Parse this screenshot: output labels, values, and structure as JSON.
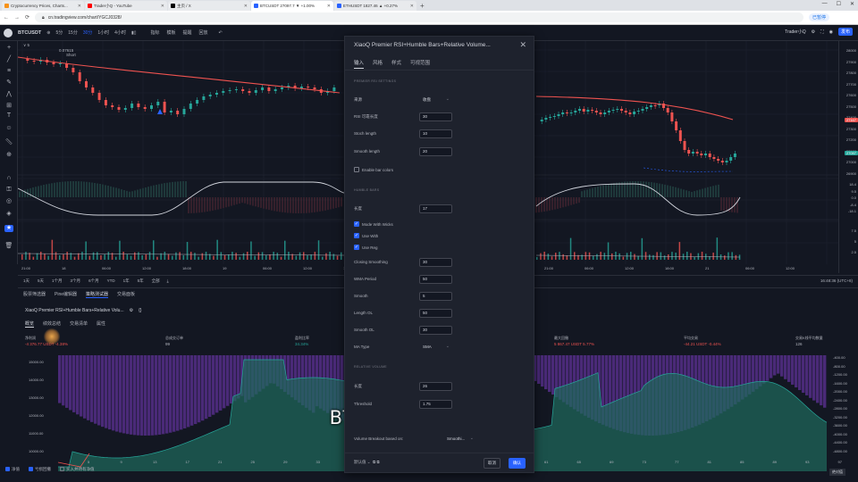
{
  "browser": {
    "tabs": [
      {
        "title": "Cryptocurrency Prices, Charts...",
        "color": "#f7931a"
      },
      {
        "title": "Trader小Q - YouTube",
        "color": "#ff0000"
      },
      {
        "title": "主页 / X",
        "color": "#000000"
      },
      {
        "title": "BTCUSDT 27097.7 ▼ +1.00%",
        "color": "#2962ff",
        "active": true
      },
      {
        "title": "ETHUSDT 1827.46 ▲ +0.27%",
        "color": "#2962ff"
      }
    ],
    "new_tab": "+",
    "url": "cn.tradingview.com/chart/YGCJ0328/",
    "profile": "已暂停"
  },
  "toolbar": {
    "symbol": "BTCUSDT",
    "intervals": [
      "5分",
      "15分",
      "30分",
      "1小时",
      "4小时"
    ],
    "active_interval": "30分",
    "items": [
      "指标",
      "模板",
      "提醒",
      "回放"
    ],
    "right": [
      "Trader小Q",
      "发布"
    ]
  },
  "legend": {
    "line1": "∨ 5",
    "line2": "0.07615",
    "line3": "Short"
  },
  "price_axis": {
    "labels": [
      "28000",
      "27900",
      "27800",
      "27700",
      "27600",
      "27500",
      "27400",
      "27300",
      "27200",
      "27100",
      "27000",
      "26900"
    ],
    "tags": [
      {
        "text": "27167",
        "color": "#ef5350"
      },
      {
        "text": "27097",
        "color": "#26a69a"
      }
    ],
    "osc_labels": [
      "18.4",
      "9.5",
      "0.0",
      "-8.4",
      "-18.1"
    ],
    "vol_labels": [
      "7.5",
      "5",
      "2.5"
    ]
  },
  "time_axis": [
    "21:00",
    "18",
    "06:00",
    "12:00",
    "18:00",
    "19",
    "06:00",
    "12:00",
    "18:00",
    "20",
    "06:00",
    "12:00",
    "18:00",
    "21:00",
    "06:00",
    "12:00",
    "18:00",
    "21",
    "06:00",
    "12:00"
  ],
  "range_bar": {
    "items": [
      "1天",
      "5天",
      "1个月",
      "3个月",
      "6个月",
      "YTD",
      "1年",
      "5年",
      "全部"
    ],
    "timezone": "16:48:36 (UTC+8)"
  },
  "panel": {
    "tabs": [
      "股票筛选器",
      "Pine编辑器",
      "策略测试器",
      "交易面板"
    ],
    "active_tab": "策略测试器",
    "strategy": "XiaoQ Premier RSI+Humble Bars+Relative Volu...",
    "subtabs": [
      "概览",
      "绩效总结",
      "交易清单",
      "属性"
    ],
    "active_subtab": "概览",
    "metrics": [
      {
        "label": "净利润",
        "value": "-4 376.77 USDT  -4.38%",
        "color": "red"
      },
      {
        "label": "总成交订单",
        "value": "99",
        "color": "neutral"
      },
      {
        "label": "盈利比率",
        "value": "34.34%",
        "color": "green"
      },
      {
        "label": "盈利因子",
        "value": "0.806",
        "color": "red"
      },
      {
        "label": "最大回撤",
        "value": "5 867.47 USDT  5.77%",
        "color": "red"
      },
      {
        "label": "平均交易",
        "value": "-44.21 USDT  -0.44%",
        "color": "red"
      },
      {
        "label": "交易K线平均数量",
        "value": "126",
        "color": "neutral"
      }
    ],
    "y_labels": [
      "15000.00",
      "14000.00",
      "13000.00",
      "12000.00",
      "11000.00",
      "10000.00"
    ],
    "right_labels": [
      "-400.00",
      "-800.00",
      "-1200.00",
      "-1600.00",
      "-2000.00",
      "-2400.00",
      "-2800.00",
      "-3200.00",
      "-3600.00",
      "-4000.00",
      "-4400.00",
      "-4800.00"
    ],
    "x_labels": [
      "5",
      "9",
      "13",
      "17",
      "21",
      "25",
      "29",
      "33",
      "37",
      "41",
      "45",
      "49",
      "53",
      "57",
      "61",
      "65",
      "69",
      "73",
      "77",
      "81",
      "85",
      "89",
      "93",
      "97"
    ],
    "footer": [
      {
        "label": "净值",
        "checked": true
      },
      {
        "label": "亏损回撤",
        "checked": true
      },
      {
        "label": "买入并持有净值",
        "checked": false
      }
    ],
    "corner": "绝对值"
  },
  "dialog": {
    "title": "XiaoQ Premier RSI+Humble Bars+Relative Volume...",
    "tabs": [
      "输入",
      "风格",
      "样式",
      "可视范围"
    ],
    "active_tab": "输入",
    "section1": "PREMIER RSI SETTINGS",
    "source_label": "来源",
    "source_value": "收盘",
    "rsi_len_label": "RSI 可靠长度",
    "rsi_len_value": "30",
    "stoch_label": "Stoch length",
    "stoch_value": "10",
    "smooth_label": "Smooth length",
    "smooth_value": "20",
    "enable_label": "Enable bar colors",
    "section2": "HUMBLE BARS",
    "len_label": "长度",
    "len_value": "17",
    "checks": [
      "Mode With Wicks",
      "Use With",
      "Use Reg"
    ],
    "closing_label": "Closing Smoothing",
    "closing_value": "30",
    "wma_label": "WMA Period",
    "wma_value": "50",
    "smooth2_label": "Smooth",
    "smooth2_value": "5",
    "lengthol_label": "Length OL",
    "lengthol_value": "50",
    "smoothol_label": "Smooth OL",
    "smoothol_value": "30",
    "matype_label": "MA Type",
    "matype_value": "SMA",
    "section3": "RELATIVE VOLUME",
    "len3_label": "长度",
    "len3_value": "26",
    "thresh_label": "Threshold",
    "thresh_value": "1.75",
    "vol_label": "Volume Breakout based on:",
    "vol_value": "Smoothi...",
    "default_label": "默认值",
    "cancel": "取消",
    "ok": "确认"
  },
  "subtitle": "BTCUSDT 30分钟图表"
}
